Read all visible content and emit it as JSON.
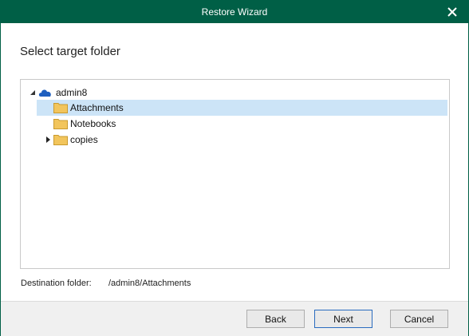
{
  "window": {
    "title": "Restore Wizard",
    "close_icon": "close-icon"
  },
  "page": {
    "heading": "Select target folder"
  },
  "tree": {
    "root": {
      "label": "admin8",
      "icon": "onedrive-cloud-icon",
      "expanded": true
    },
    "items": [
      {
        "label": "Attachments",
        "icon": "folder-icon",
        "selected": true,
        "has_children": false
      },
      {
        "label": "Notebooks",
        "icon": "folder-icon",
        "selected": false,
        "has_children": false
      },
      {
        "label": "copies",
        "icon": "folder-icon",
        "selected": false,
        "has_children": true
      }
    ]
  },
  "destination": {
    "label": "Destination folder:",
    "value": "/admin8/Attachments"
  },
  "buttons": {
    "back": "Back",
    "next": "Next",
    "cancel": "Cancel"
  },
  "colors": {
    "titlebar": "#005f46",
    "selection": "#cce4f7",
    "folder": "#f2c55c",
    "cloud": "#1e5fbf"
  }
}
